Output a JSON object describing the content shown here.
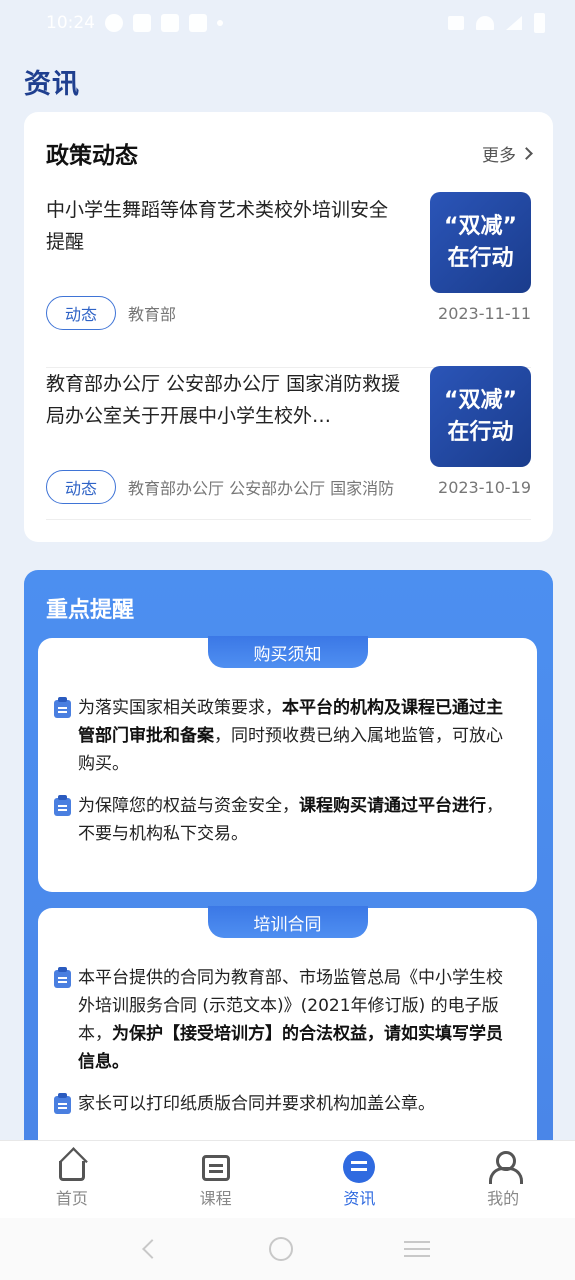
{
  "status_bar": {
    "time": "10:24"
  },
  "page_title": "资讯",
  "policy": {
    "title": "政策动态",
    "more_label": "更多",
    "items": [
      {
        "title": "中小学生舞蹈等体育艺术类校外培训安全提醒",
        "thumb_line1": "“双减”",
        "thumb_line2": "在行动",
        "tag": "动态",
        "source": "教育部",
        "date": "2023-11-11"
      },
      {
        "title": "教育部办公厅 公安部办公厅 国家消防救援局办公室关于开展中小学生校外…",
        "thumb_line1": "“双减”",
        "thumb_line2": "在行动",
        "tag": "动态",
        "source": "教育部办公厅 公安部办公厅 国家消防",
        "date": "2023-10-19"
      }
    ]
  },
  "reminder": {
    "title": "重点提醒",
    "cards": [
      {
        "pill": "购买须知",
        "lines": [
          {
            "prefix": "为落实国家相关政策要求，",
            "bold": "本平台的机构及课程已通过主管部门审批和备案",
            "suffix": "，同时预收费已纳入属地监管，可放心购买。"
          },
          {
            "prefix": "为保障您的权益与资金安全，",
            "bold": "课程购买请通过平台进行",
            "suffix": "，不要与机构私下交易。"
          }
        ]
      },
      {
        "pill": "培训合同",
        "lines": [
          {
            "prefix": "本平台提供的合同为教育部、市场监管总局《中小学生校外培训服务合同 (示范文本)》(2021年修订版) 的电子版本，",
            "bold": "为保护【接受培训方】的合法权益，请如实填写学员信息。",
            "suffix": ""
          },
          {
            "prefix": "家长可以打印纸质版合同并要求机构加盖公章。",
            "bold": "",
            "suffix": ""
          }
        ]
      }
    ]
  },
  "bottom_nav": {
    "items": [
      {
        "label": "首页",
        "icon": "home-icon"
      },
      {
        "label": "课程",
        "icon": "calendar-icon"
      },
      {
        "label": "资讯",
        "icon": "chat-icon",
        "active": true
      },
      {
        "label": "我的",
        "icon": "user-icon"
      }
    ]
  },
  "colors": {
    "accent": "#2f6ae0",
    "title": "#1f3f8f",
    "panel": "#4a86e8"
  }
}
